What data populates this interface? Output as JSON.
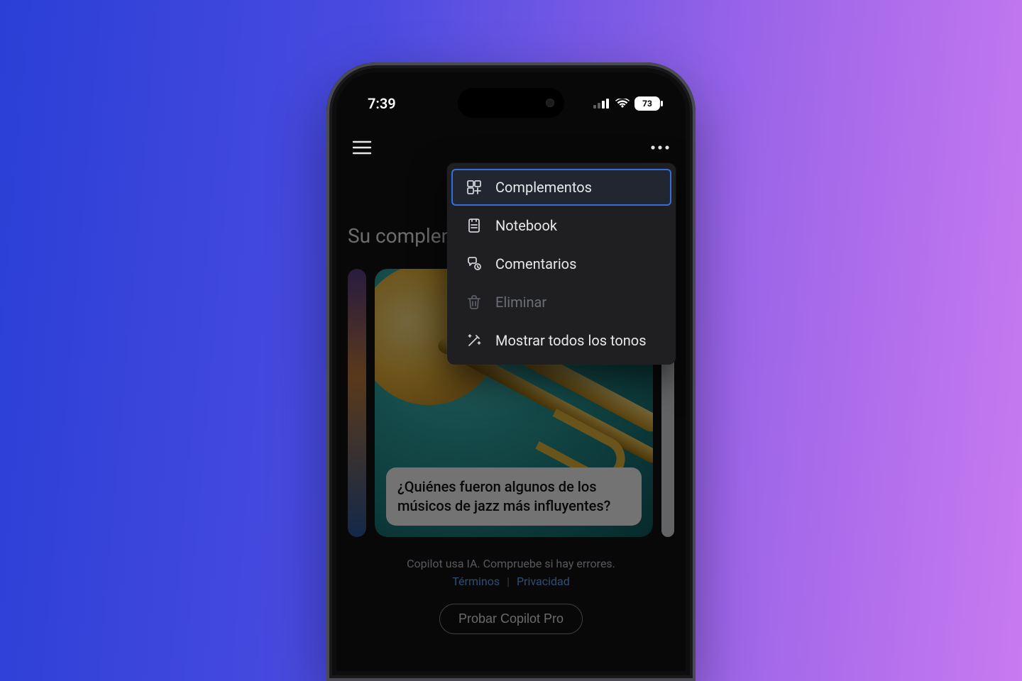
{
  "statusbar": {
    "time": "7:39",
    "battery_percent": "73"
  },
  "app": {
    "heading_truncated": "Su complemen"
  },
  "card": {
    "prompt": "¿Quiénes fueron algunos de los músicos de jazz más influyentes?"
  },
  "footer": {
    "disclaimer": "Copilot usa IA. Compruebe si hay errores.",
    "terms": "Términos",
    "privacy": "Privacidad",
    "pro_cta": "Probar Copilot Pro"
  },
  "menu": {
    "items": [
      {
        "id": "complementos",
        "label": "Complementos",
        "icon": "plugins-icon",
        "selected": true,
        "disabled": false
      },
      {
        "id": "notebook",
        "label": "Notebook",
        "icon": "notebook-icon",
        "selected": false,
        "disabled": false
      },
      {
        "id": "comentarios",
        "label": "Comentarios",
        "icon": "feedback-icon",
        "selected": false,
        "disabled": false
      },
      {
        "id": "eliminar",
        "label": "Eliminar",
        "icon": "trash-icon",
        "selected": false,
        "disabled": true
      },
      {
        "id": "tonos",
        "label": "Mostrar todos los tonos",
        "icon": "wand-icon",
        "selected": false,
        "disabled": false
      }
    ]
  }
}
